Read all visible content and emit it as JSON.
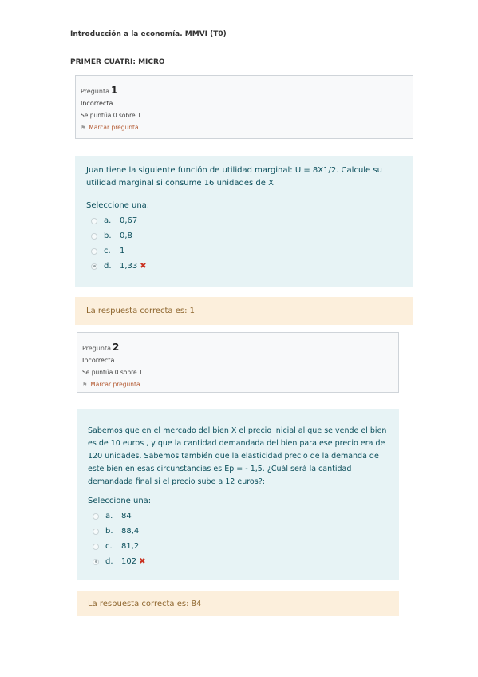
{
  "doc_title": "Introducción a la economía. MMVI (T0)",
  "doc_subtitle": "PRIMER CUATRI: MICRO",
  "questions": [
    {
      "label": "Pregunta",
      "number": "1",
      "state": "Incorrecta",
      "grade": "Se puntúa 0 sobre 1",
      "flag": "Marcar pregunta",
      "intro": "",
      "text": "Juan tiene la siguiente función de utilidad marginal: U = 8X1/2. Calcule su utilidad marginal si consume 16 unidades de X",
      "prompt": "Seleccione una:",
      "answers": [
        {
          "letter": "a.",
          "value": "0,67",
          "selected": false
        },
        {
          "letter": "b.",
          "value": "0,8",
          "selected": false
        },
        {
          "letter": "c.",
          "value": "1",
          "selected": false
        },
        {
          "letter": "d.",
          "value": "1,33",
          "selected": true
        }
      ],
      "feedback": "La respuesta correcta es: 1"
    },
    {
      "label": "Pregunta",
      "number": "2",
      "state": "Incorrecta",
      "grade": "Se puntúa 0 sobre 1",
      "flag": "Marcar pregunta",
      "intro": ":",
      "text": "Sabemos que en el mercado del bien X el precio inicial al que se vende el bien es de 10 euros , y que la cantidad demandada del bien para ese precio era de 120 unidades. Sabemos también que la elasticidad precio de la demanda de este bien en esas circunstancias es Ep  = - 1,5. ¿Cuál será la cantidad demandada final si el precio sube a 12 euros?:",
      "prompt": "Seleccione una:",
      "answers": [
        {
          "letter": "a.",
          "value": "84",
          "selected": false
        },
        {
          "letter": "b.",
          "value": "88,4",
          "selected": false
        },
        {
          "letter": "c.",
          "value": "81,2",
          "selected": false
        },
        {
          "letter": "d.",
          "value": "102",
          "selected": true
        }
      ],
      "feedback": "La respuesta correcta es: 84"
    }
  ],
  "icons": {
    "flag": "flag-icon",
    "wrong": "cross-icon",
    "radio": "radio-icon"
  },
  "colors": {
    "question_bg": "#e7f3f5",
    "feedback_bg": "#fcefdc",
    "wrong": "#ca3120",
    "flag_link": "#b45a32"
  }
}
